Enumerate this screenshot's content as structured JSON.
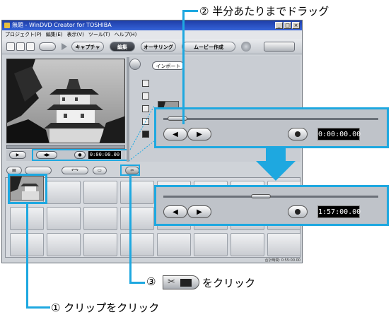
{
  "window": {
    "title": "無題 - WinDVD Creator for TOSHIBA",
    "controls": [
      "_",
      "□",
      "×"
    ]
  },
  "menu": [
    "プロジェクト(P)",
    "編集(E)",
    "表示(V)",
    "ツール(T)",
    "ヘルプ(H)"
  ],
  "toolbar": {
    "modes": [
      {
        "label": "キャプチャ",
        "active": false
      },
      {
        "label": "編集",
        "active": true
      },
      {
        "label": "オーサリング",
        "active": false
      },
      {
        "label": "ムービー作成",
        "active": false
      }
    ]
  },
  "preview": {
    "time": "0:00:00.00",
    "play_icon": "play-icon",
    "prev_icon": "prev-frame-icon",
    "next_icon": "next-frame-icon",
    "snapshot_icon": "camera-icon"
  },
  "media": {
    "import_label": "インポート"
  },
  "storyboard": {
    "status": "合計時間: 0:55:00.00",
    "thumbnail_count": 1
  },
  "zoom_panels": [
    {
      "time": "0:00:00.00",
      "slider_fraction": 0.02
    },
    {
      "time": "1:57:00.00",
      "slider_fraction": 0.45
    }
  ],
  "annotations": {
    "step1": "① クリップをクリック",
    "step2": "② 半分あたりまでドラッグ",
    "step3_prefix": "③",
    "step3_suffix": "をクリック"
  },
  "colors": {
    "accent": "#1ea8e0",
    "titlebar": "#2a50c0"
  }
}
